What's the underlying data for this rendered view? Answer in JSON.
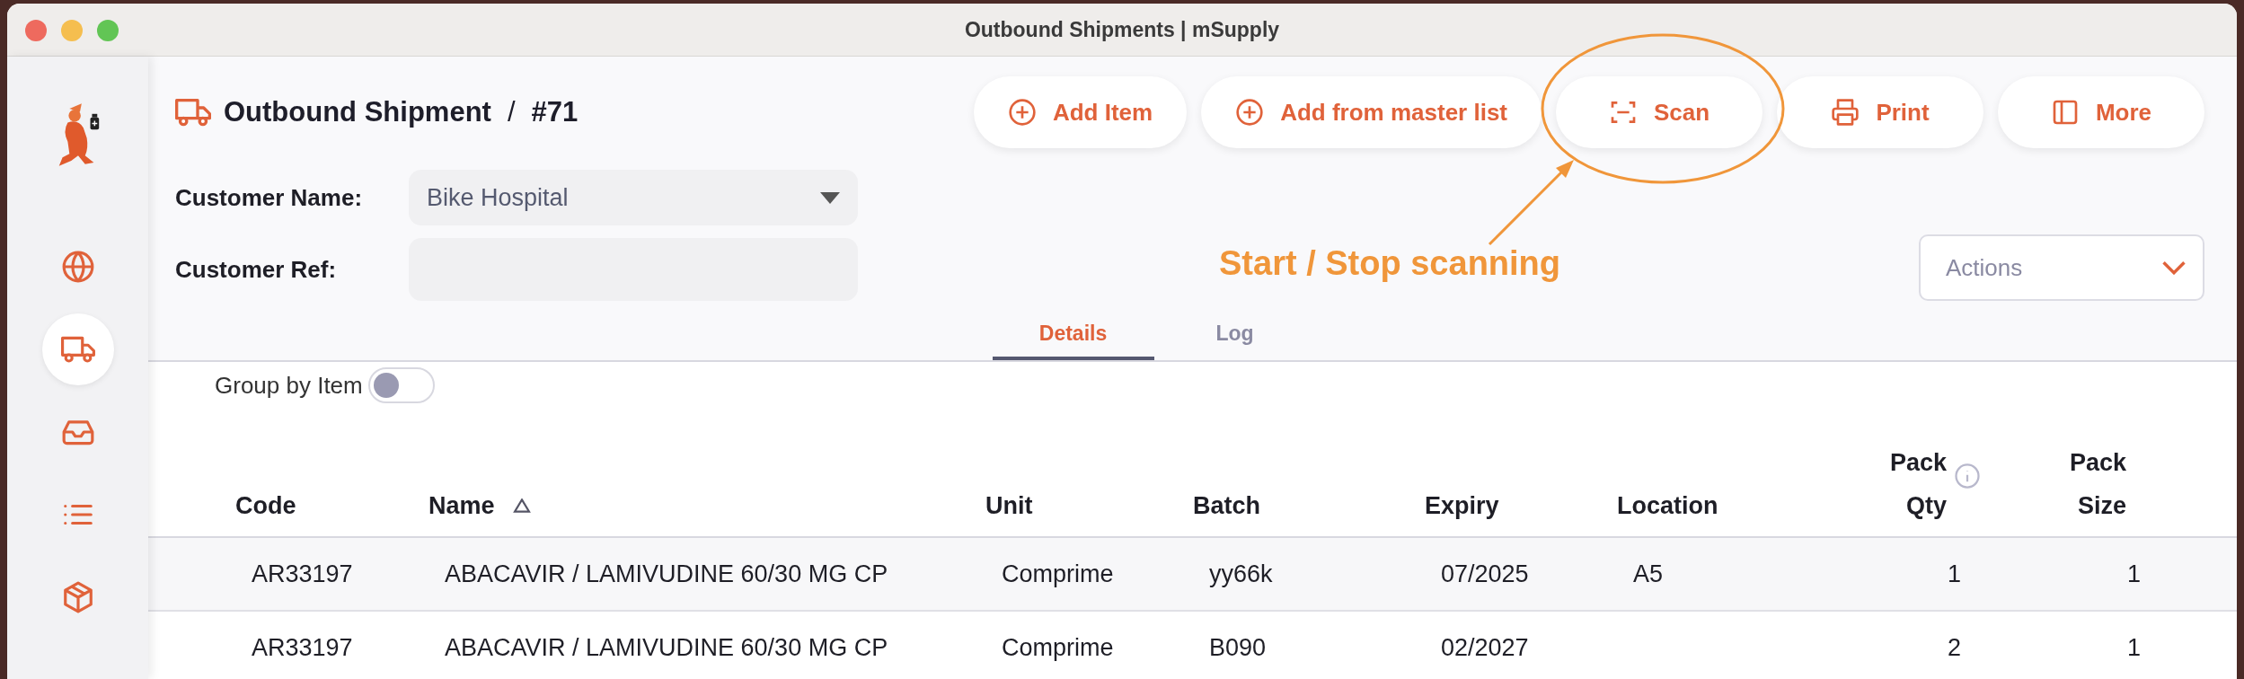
{
  "window": {
    "title": "Outbound Shipments | mSupply"
  },
  "sidebar": {
    "items": [
      {
        "kind": "globe",
        "selected": false
      },
      {
        "kind": "truck",
        "selected": true
      },
      {
        "kind": "inbox",
        "selected": false
      },
      {
        "kind": "list",
        "selected": false
      },
      {
        "kind": "box",
        "selected": false
      }
    ]
  },
  "header": {
    "title": "Outbound Shipment",
    "separator": "/",
    "number": "#71"
  },
  "toolbar": {
    "buttons": [
      {
        "kind": "add",
        "label": "Add Item"
      },
      {
        "kind": "add",
        "label": "Add from master list"
      },
      {
        "kind": "scan",
        "label": "Scan"
      },
      {
        "kind": "print",
        "label": "Print"
      },
      {
        "kind": "more",
        "label": "More"
      }
    ]
  },
  "form": {
    "fields": [
      {
        "kind": "select",
        "label": "Customer Name:",
        "value": "Bike Hospital"
      },
      {
        "kind": "text",
        "label": "Customer Ref:"
      }
    ]
  },
  "actions": {
    "label": "Actions"
  },
  "annotation": {
    "text": "Start / Stop scanning"
  },
  "tabs": [
    {
      "label": "Details",
      "selected": true
    },
    {
      "label": "Log",
      "selected": false
    }
  ],
  "group_by_item": {
    "label": "Group by Item",
    "on": false
  },
  "table": {
    "columns": [
      {
        "label": "Code",
        "numeric": false,
        "sorted_ascending": false
      },
      {
        "label": "Name",
        "numeric": false,
        "sorted_ascending": true
      },
      {
        "label": "Unit",
        "numeric": false,
        "sorted_ascending": false
      },
      {
        "label": "Batch",
        "numeric": false,
        "sorted_ascending": false
      },
      {
        "label": "Expiry",
        "numeric": false,
        "sorted_ascending": false
      },
      {
        "label": "Location",
        "numeric": false,
        "sorted_ascending": false
      },
      {
        "label": "Pack Qty",
        "numeric": true,
        "sorted_ascending": false,
        "info": true
      },
      {
        "label": "Pack Size",
        "numeric": true,
        "sorted_ascending": false
      }
    ],
    "rows": [
      {
        "highlighted": true,
        "cells": [
          "AR33197",
          "ABACAVIR / LAMIVUDINE 60/30 MG CP",
          "Comprime",
          "yy66k",
          "07/2025",
          "A5",
          "1",
          "1"
        ]
      },
      {
        "highlighted": false,
        "cells": [
          "AR33197",
          "ABACAVIR / LAMIVUDINE 60/30 MG CP",
          "Comprime",
          "B090",
          "02/2027",
          "",
          "2",
          "1"
        ]
      }
    ]
  }
}
